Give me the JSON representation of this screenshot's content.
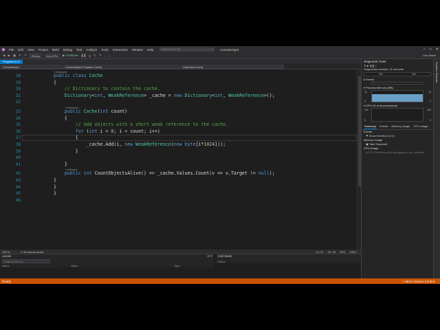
{
  "app": {
    "menu": [
      "File",
      "Edit",
      "View",
      "Project",
      "Build",
      "Debug",
      "Test",
      "Analyze",
      "Tools",
      "Extensions",
      "Window",
      "Help"
    ],
    "search_placeholder": "Search (Ctrl+Q)",
    "solution_name": "ConsoleApp4",
    "live_share": "Live Share"
  },
  "toolbar": {
    "continue_label": "Continue",
    "config_combo": "Debug",
    "platform_combo": "Any CPU",
    "process_combo": "Process: [1234] ConsoleApp4.exe"
  },
  "tabs": [
    {
      "label": "Program.cs",
      "active": true
    },
    {
      "label": "ConsoleApp4",
      "active": false
    }
  ],
  "navbar": {
    "project": "ConsoleApp4",
    "class": "ConsoleApp4.Program.Cache",
    "member": "Cache(int count)"
  },
  "editor": {
    "current_line": 37,
    "lines": [
      {
        "n": "28",
        "html": "<span class='kw'>public class</span> <span class='ty'>Cache</span>"
      },
      {
        "n": "29",
        "html": "{"
      },
      {
        "n": "30",
        "html": "    <span class='cm'>// Dictionary to contain the cache.</span>"
      },
      {
        "n": "31",
        "html": "    <span class='ty'>Dictionary</span>&lt;<span class='kw'>int</span>, <span class='ty'>WeakReference</span>&gt; _cache = <span class='kw'>new</span> <span class='ty'>Dictionary</span>&lt;<span class='kw'>int</span>, <span class='ty'>WeakReference</span>&gt;();"
      },
      {
        "n": "32",
        "html": ""
      },
      {
        "n": "33",
        "html": "    <span class='kw'>public</span> <span class='ty'>Cache</span>(<span class='kw'>int</span> count)"
      },
      {
        "n": "34",
        "html": "    {"
      },
      {
        "n": "35",
        "html": "        <span class='cm'>// Add objects with a short weak reference to the cache.</span>"
      },
      {
        "n": "36",
        "html": "        <span class='kw'>for</span> (<span class='kw'>int</span> i = <span class='nm'>0</span>; i &lt; count; i++)"
      },
      {
        "n": "37",
        "html": "        {"
      },
      {
        "n": "38",
        "html": "            _cache.Add(i, <span class='kw'>new</span> <span class='ty'>WeakReference</span>(<span class='kw'>new byte</span>[i*<span class='nm'>1024</span>]));"
      },
      {
        "n": "39",
        "html": "        }"
      },
      {
        "n": "40",
        "html": ""
      },
      {
        "n": "41",
        "html": "    }"
      },
      {
        "n": "42",
        "html": "    <span class='kw'>public int</span> CountObjectsAlive() =&gt; _cache.Values.Count(v =&gt; v.Target != <span class='kw'>null</span>);"
      },
      {
        "n": "43",
        "html": "}"
      },
      {
        "n": "44",
        "html": "}"
      },
      {
        "n": "45",
        "html": "}"
      },
      {
        "n": "46",
        "html": ""
      }
    ],
    "refs": [
      "0 references",
      "0 references",
      "1 reference"
    ]
  },
  "editor_status": {
    "zoom": "100 %",
    "issues": "No issues found",
    "position": "Ln: 37",
    "column": "Ch: 10",
    "spc": "SPC",
    "crlf": "CRLF"
  },
  "locals": {
    "title": "Locals",
    "search": "Search (Ctrl+E)",
    "columns": [
      "Name",
      "Value",
      "Type"
    ]
  },
  "callstack": {
    "title": "Call Stack",
    "columns": [
      "Name",
      "Lang"
    ]
  },
  "bottom_tabs_left": [
    "Locals",
    "Watch 1"
  ],
  "bottom_tabs_right": [
    "Call Stack",
    "Exception Settings",
    "Immediate Window"
  ],
  "diagnostics": {
    "title": "Diagnostic Tools",
    "session": "Diagnostics session: 41 seconds",
    "timeline_ticks": [
      "30s",
      "40s"
    ],
    "events_label": "Events",
    "memory_label": "Process Memory (MB)",
    "memory_axis_top": "12",
    "memory_axis_bottom": "0",
    "cpu_label": "CPU (% of all processors)",
    "cpu_axis_top": "100",
    "cpu_axis_bottom": "0",
    "tabs": [
      "Summary",
      "Events",
      "Memory Usage",
      "CPU Usage"
    ],
    "events_head": "Events",
    "events_row": "Show Events (0 of 0)",
    "memory_head": "Memory Usage",
    "memory_row": "Take Snapshot",
    "cpu_head": "CPU Usage",
    "cpu_row": "CPU Profiling while debugging is not available"
  },
  "edge_label": "Solution Explorer",
  "status": {
    "left": "Ready",
    "right": "Add to Source Control"
  }
}
